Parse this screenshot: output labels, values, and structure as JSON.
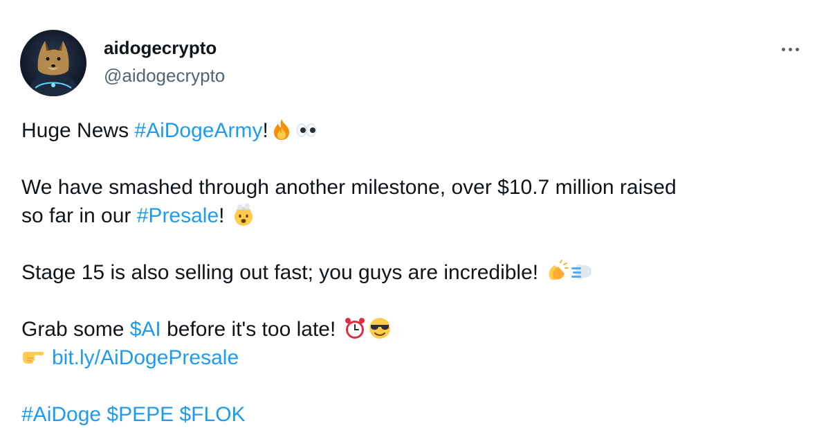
{
  "author": {
    "display_name": "aidogecrypto",
    "handle": "@aidogecrypto",
    "avatar": "doge-warrior-avatar"
  },
  "menu": {
    "more_icon": "more-horizontal-icon"
  },
  "tweet": {
    "line1": {
      "text": "Huge News ",
      "hashtag": "#AiDogeArmy",
      "after": "!",
      "emojis": [
        "fire-emoji",
        "eyes-emoji"
      ]
    },
    "line2": {
      "text": "We have smashed through another milestone, over $10.7 million raised"
    },
    "line3": {
      "text": "so far in our ",
      "hashtag": "#Presale",
      "after": "! ",
      "emojis": [
        "exploding-head-emoji"
      ]
    },
    "line4": {
      "text": "Stage 15 is also selling out fast; you guys are incredible! ",
      "emojis": [
        "clapping-hands-emoji",
        "dashing-away-emoji"
      ]
    },
    "line5": {
      "text": "Grab some ",
      "cashtag": "$AI",
      "after": " before it's too late! ",
      "emojis": [
        "alarm-clock-emoji",
        "sunglasses-face-emoji"
      ]
    },
    "line6": {
      "emoji": "pointing-right-emoji",
      "link": "bit.ly/AiDogePresale"
    },
    "line7": {
      "tags": [
        "#AiDoge",
        "$PEPE",
        "$FLOK"
      ]
    }
  },
  "colors": {
    "link": "#1d9bf0",
    "text": "#0f1419",
    "secondary": "#536471"
  }
}
